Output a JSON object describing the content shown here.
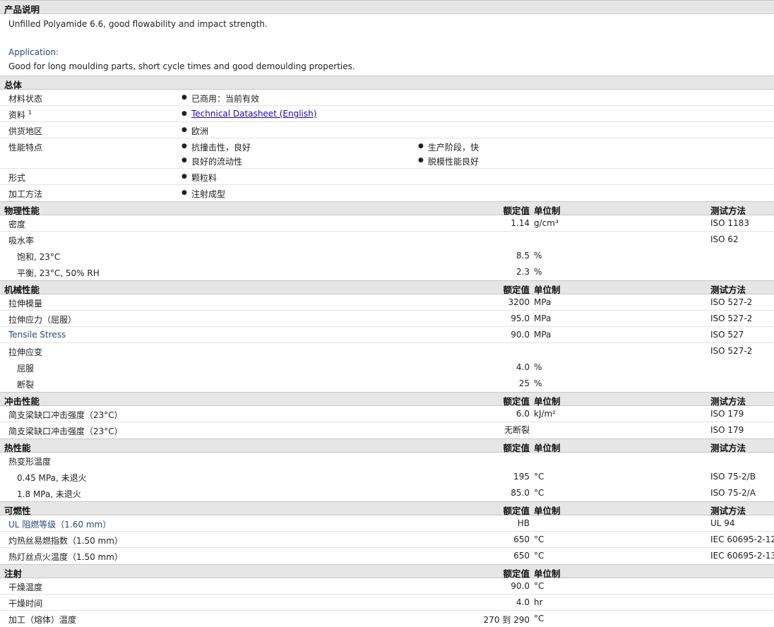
{
  "product_desc": {
    "title": "产品说明",
    "line1": "Unfilled Polyamide 6.6, good flowability and impact strength.",
    "line2": "Application:",
    "line3": "Good for long moulding parts, short cycle times and good demoulding properties."
  },
  "general": {
    "title": "总体",
    "rows": {
      "status": {
        "label": "材料状态",
        "v1": "已商用：当前有效"
      },
      "docs": {
        "label": "资料",
        "sup": "1",
        "v1": "Technical Datasheet (English)"
      },
      "region": {
        "label": "供货地区",
        "v1": "欧洲"
      },
      "features": {
        "label": "性能特点",
        "v1": "抗撞击性，良好",
        "v2": "生产阶段，快",
        "v3": "良好的流动性",
        "v4": "脱模性能良好"
      },
      "form": {
        "label": "形式",
        "v1": "颗粒料"
      },
      "process": {
        "label": "加工方法",
        "v1": "注射成型"
      }
    }
  },
  "headers": {
    "value": "额定值",
    "unit": "单位制",
    "method": "测试方法"
  },
  "physical": {
    "title": "物理性能",
    "rows": [
      {
        "label": "密度",
        "value": "1.14",
        "unit": "g/cm³",
        "method": "ISO 1183"
      },
      {
        "label": "吸水率",
        "value": "",
        "unit": "",
        "method": "ISO 62"
      },
      {
        "label": "饱和, 23°C",
        "value": "8.5",
        "unit": "%",
        "method": ""
      },
      {
        "label": "平衡, 23°C, 50% RH",
        "value": "2.3",
        "unit": "%",
        "method": ""
      }
    ]
  },
  "mechanical": {
    "title": "机械性能",
    "rows": [
      {
        "label": "拉伸模量",
        "value": "3200",
        "unit": "MPa",
        "method": "ISO 527-2"
      },
      {
        "label": "拉伸应力（屈服）",
        "value": "95.0",
        "unit": "MPa",
        "method": "ISO 527-2"
      },
      {
        "label": "Tensile Stress",
        "value": "90.0",
        "unit": "MPa",
        "method": "ISO 527"
      },
      {
        "label": "拉伸应变",
        "value": "",
        "unit": "",
        "method": "ISO 527-2"
      },
      {
        "label": "屈服",
        "value": "4.0",
        "unit": "%",
        "method": ""
      },
      {
        "label": "断裂",
        "value": "25",
        "unit": "%",
        "method": ""
      }
    ]
  },
  "impact": {
    "title": "冲击性能",
    "rows": [
      {
        "label": "简支梁缺口冲击强度（23°C）",
        "value": "6.0",
        "unit": "kJ/m²",
        "method": "ISO 179"
      },
      {
        "label": "简支梁缺口冲击强度（23°C）",
        "value": "无断裂",
        "unit": "",
        "method": "ISO 179"
      }
    ]
  },
  "thermal": {
    "title": "热性能",
    "rows": [
      {
        "label": "热变形温度",
        "value": "",
        "unit": "",
        "method": ""
      },
      {
        "label": "0.45 MPa, 未退火",
        "value": "195",
        "unit": "°C",
        "method": "ISO 75-2/B"
      },
      {
        "label": "1.8 MPa, 未退火",
        "value": "85.0",
        "unit": "°C",
        "method": "ISO 75-2/A"
      }
    ]
  },
  "flammability": {
    "title": "可燃性",
    "rows": [
      {
        "label": "UL 阻燃等级（1.60 mm）",
        "value": "HB",
        "unit": "",
        "method": "UL 94"
      },
      {
        "label": "灼热丝易燃指数（1.50 mm）",
        "value": "650",
        "unit": "°C",
        "method": "IEC 60695-2-12"
      },
      {
        "label": "热灯丝点火温度（1.50 mm）",
        "value": "650",
        "unit": "°C",
        "method": "IEC 60695-2-13"
      }
    ]
  },
  "injection": {
    "title": "注射",
    "rows": [
      {
        "label": "干燥温度",
        "value": "90.0",
        "unit": "°C",
        "method": ""
      },
      {
        "label": "干燥时间",
        "value": "4.0",
        "unit": "hr",
        "method": ""
      },
      {
        "label": "加工（熔体）温度",
        "value": "270 到 290",
        "unit": "°C",
        "method": ""
      }
    ]
  }
}
